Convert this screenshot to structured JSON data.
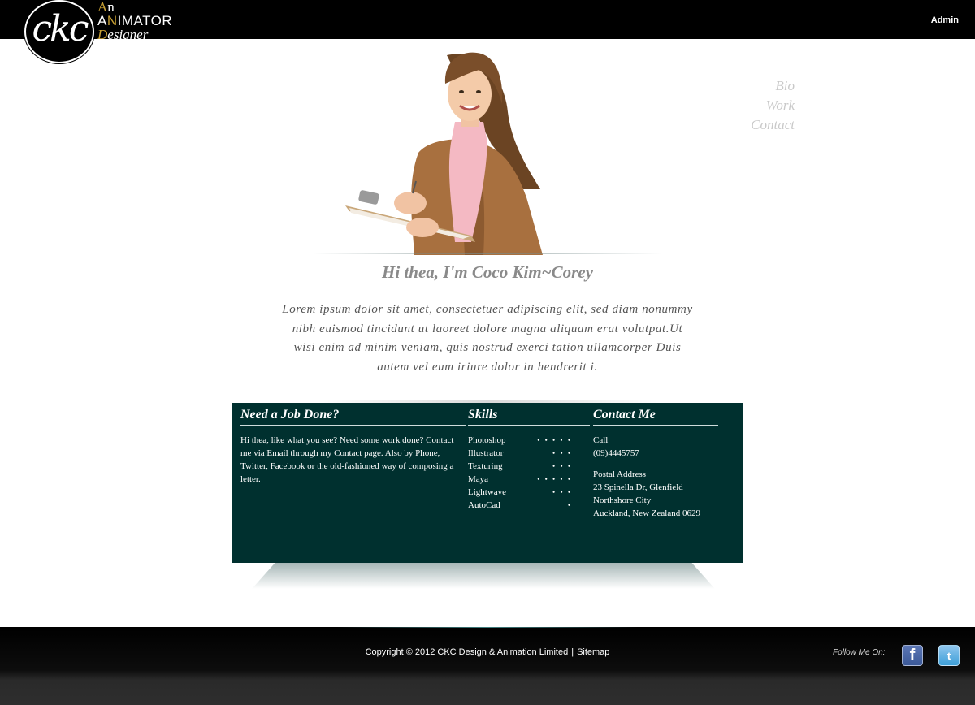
{
  "header": {
    "logo_text": "ckc",
    "tagline": {
      "line1_accent": "A",
      "line1_rest": "n",
      "line2_a": "A",
      "line2_b": "N",
      "line2_c": "IMATOR",
      "line3_accent": "D",
      "line3_rest": "esigner"
    },
    "admin_label": "Admin"
  },
  "nav": {
    "items": [
      "Bio",
      "Work",
      "Contact"
    ]
  },
  "hero": {
    "greeting": "Hi thea, I'm Coco Kim~Corey",
    "intro": "Lorem ipsum dolor sit amet, consectetuer adipiscing elit, sed diam nonummy nibh euismod tincidunt ut laoreet dolore magna aliquam erat volutpat.Ut wisi enim ad minim veniam, quis nostrud exerci tation ullamcorper Duis autem vel eum iriure dolor in hendrerit i."
  },
  "panel": {
    "job": {
      "heading": "Need a Job Done?",
      "text": "Hi thea, like what you see? Need some work done? Contact me via Email through my Contact page. Also by Phone, Twitter, Facebook or the old-fashioned way of composing a letter."
    },
    "skills": {
      "heading": "Skills",
      "items": [
        {
          "name": "Photoshop",
          "dots": "• • • • •"
        },
        {
          "name": "Illustrator",
          "dots": "• • •"
        },
        {
          "name": "Texturing",
          "dots": "• • •"
        },
        {
          "name": "Maya",
          "dots": "• • • • •"
        },
        {
          "name": "Lightwave",
          "dots": "• • •"
        },
        {
          "name": "AutoCad",
          "dots": "•"
        }
      ]
    },
    "contact": {
      "heading": "Contact Me",
      "call_label": "Call",
      "phone": "(09)4445757",
      "address_label": "Postal Address",
      "address_lines": [
        "23 Spinella Dr, Glenfield",
        "Northshore City",
        "Auckland, New Zealand 0629"
      ]
    }
  },
  "footer": {
    "copyright": "Copyright © 2012 CKC Design & Animation Limited",
    "separator": "|",
    "sitemap": "Sitemap",
    "follow_label": "Follow Me On:",
    "facebook_glyph": "f",
    "twitter_glyph": "t"
  },
  "colors": {
    "panel_bg": "#00302f",
    "accent_gold": "#c8a034",
    "nav_text": "#c9c9c9"
  }
}
